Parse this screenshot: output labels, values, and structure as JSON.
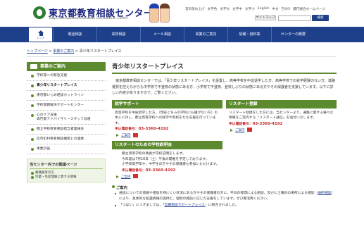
{
  "header": {
    "title": "東京都教育相談センター",
    "subtitle": "Tokyo Metropolitan Education Consultation Center",
    "top_links": [
      "音声読み上げ",
      "文字色",
      "文字大",
      "文字中",
      "文字小",
      "English",
      "中文",
      "한국어",
      "都庁総合ホームページ"
    ],
    "sitemap_label": "サイトマップ",
    "search_placeholder": "",
    "search_button": "検索"
  },
  "nav": {
    "home_label": "トップ",
    "items": [
      "電話相談",
      "来所相談",
      "メール相談",
      "事業のご案内",
      "情報・資料等",
      "センターの概要"
    ]
  },
  "breadcrumb": {
    "items": [
      "トップページ",
      "事業のご案内"
    ],
    "separator": ">",
    "current": "青少年リスタートプレイス"
  },
  "sidebar": {
    "title": "事業のご案内",
    "items": [
      "学校等への緊急支援",
      "青少年リスタートプレイス",
      "東京都いじめ相談ホットライン",
      "学校問題解決サポートセンター",
      "心のケア支援",
      "専門家アドバイザリースタッフ派遣",
      "都立学校教育相談担当者連絡会",
      "区市町村教育相談機関との連携",
      "事業計画"
    ],
    "active_index": 1,
    "related": {
      "title": "当センター内での関連ページ",
      "items": [
        "教職員等の方",
        "児童・生徒理解に資する情報"
      ]
    }
  },
  "main": {
    "title": "青少年リスタートプレイス",
    "intro": "東京都教育相談センターでは、「青少年リスタートプレイス」を設置し、高等学校を中途退学した方、高等学校での就学経験のない方、進路選択を控えながらも中学校で不登校の状態にある方、小学校で不登校、登校しぶりの状態にある方やその保護者を支援しています。以下に詳しい内容がありますので、ご覧ください。",
    "section_left": {
      "title": "就学サポート",
      "text": "高等学校を中途退学した方、（現在どちらの学校にも籍がない方）の本人に対し、都立高等学校への就学や高校をたた支援を行っています。",
      "phone_label": "申込電話番号：",
      "phone": "03-3360-4192",
      "more": "ご案内"
    },
    "section_right": {
      "title": "リスタート登録",
      "text": "リスタート登録をした方には、当センターより、通路に関する様々な情報をご案内する「リスタート通信」を送付いたします。",
      "phone_label": "申込電話番号：",
      "phone": "03-3360-4192",
      "more": "ご案内"
    },
    "section_full": {
      "title": "リスタートのための学校説明会",
      "lines": [
        "都立高等学校の教員が学校説明をします。",
        "今年度は7月16日（土）午後の開催を予定しております。",
        "小学校高学年や、中学生の方やその保護者も参加いただけます。"
      ],
      "phone_label": "申込電話番号：",
      "phone": "03-3360-4192",
      "more": "ご案内"
    },
    "notice": {
      "title": "ご案内",
      "item1_a": "通話についての情報や相談を特にくい状況にある方やその保護者の方に、平日の夜間による相談、及びに土曜日の来所による相談（",
      "item1_link": "通所相談",
      "item1_b": "）により、具体的な処遇情報の提供と、個別の相談に応じた支援をしています。ぜひ御活用ください。",
      "item2_a": "「つばい」につきましては、「",
      "item2_link": "自費相談サポートプレイス",
      "item2_b": "」に統合されました。"
    }
  }
}
